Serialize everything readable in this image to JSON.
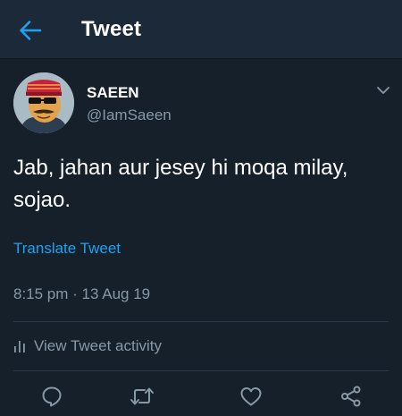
{
  "header": {
    "title": "Tweet",
    "back_icon": "back-arrow-icon"
  },
  "tweet": {
    "author": {
      "display_name": "SAEEN",
      "handle": "@IamSaeen",
      "avatar": "avatar-image"
    },
    "text": "Jab, jahan aur jesey hi moqa milay, sojao.",
    "translate_label": "Translate Tweet",
    "timestamp": "8:15 pm · 13 Aug 19",
    "activity_label": "View Tweet activity"
  },
  "actions": [
    "reply-icon",
    "retweet-icon",
    "like-icon",
    "share-icon"
  ],
  "colors": {
    "background": "#15202b",
    "header_background": "#1c2938",
    "accent": "#1da1f2",
    "secondary_text": "#8899a6",
    "divider": "#2b3a4a"
  }
}
